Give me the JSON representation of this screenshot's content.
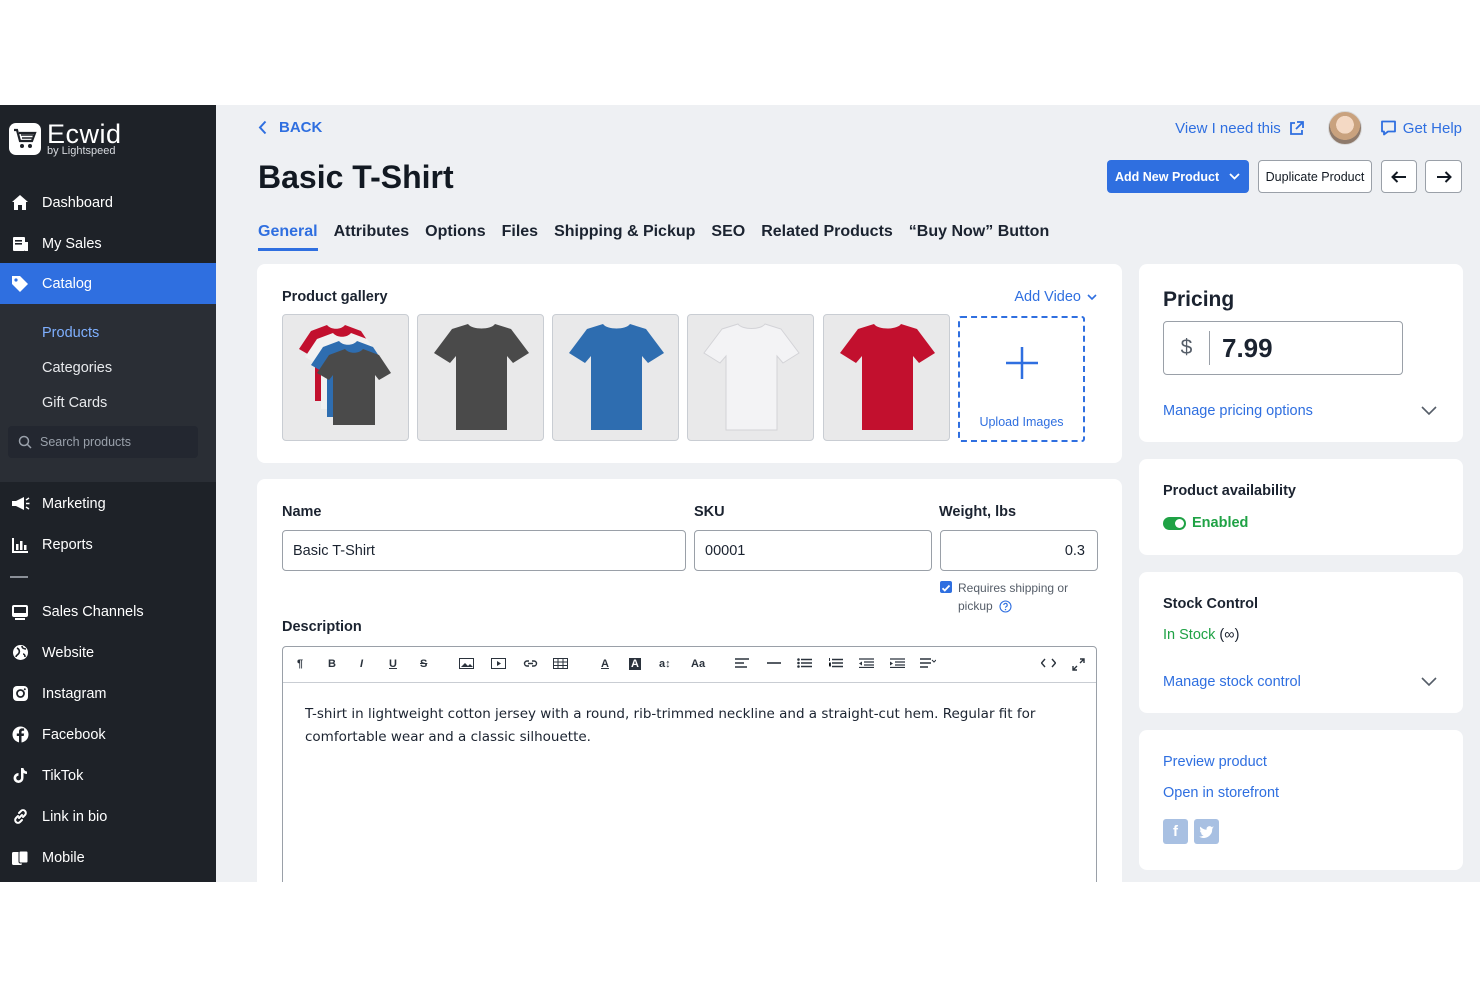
{
  "brand": {
    "name": "Ecwid",
    "sub": "by Lightspeed"
  },
  "sidebar": {
    "items": [
      {
        "label": "Dashboard",
        "icon": "home-icon"
      },
      {
        "label": "My Sales",
        "icon": "sales-icon"
      },
      {
        "label": "Catalog",
        "icon": "tag-icon",
        "active": true
      }
    ],
    "sub_items": [
      {
        "label": "Products",
        "active": true
      },
      {
        "label": "Categories"
      },
      {
        "label": "Gift Cards"
      }
    ],
    "search_placeholder": "Search products",
    "items2": [
      {
        "label": "Marketing",
        "icon": "megaphone-icon"
      },
      {
        "label": "Reports",
        "icon": "chart-icon"
      },
      {
        "label": "Sales Channels",
        "icon": "store-icon"
      },
      {
        "label": "Website",
        "icon": "globe-icon"
      },
      {
        "label": "Instagram",
        "icon": "instagram-icon"
      },
      {
        "label": "Facebook",
        "icon": "facebook-icon"
      },
      {
        "label": "TikTok",
        "icon": "tiktok-icon"
      },
      {
        "label": "Link in bio",
        "icon": "link-icon"
      },
      {
        "label": "Mobile",
        "icon": "mobile-icon"
      }
    ]
  },
  "header": {
    "back_label": "BACK",
    "title": "Basic T-Shirt",
    "view_link": "View I need this",
    "help_link": "Get Help",
    "add_new": "Add New Product",
    "duplicate": "Duplicate Product"
  },
  "tabs": [
    "General",
    "Attributes",
    "Options",
    "Files",
    "Shipping & Pickup",
    "SEO",
    "Related Products",
    "“Buy Now” Button"
  ],
  "gallery": {
    "title": "Product gallery",
    "add_video": "Add Video",
    "upload": "Upload Images",
    "thumbs": [
      {
        "kind": "stack"
      },
      {
        "kind": "single",
        "color": "#4a4a4a"
      },
      {
        "kind": "single",
        "color": "#2e6db0"
      },
      {
        "kind": "single",
        "color": "#e3e3e5"
      },
      {
        "kind": "single",
        "color": "#c2102e"
      }
    ]
  },
  "form": {
    "name_label": "Name",
    "name_value": "Basic T-Shirt",
    "sku_label": "SKU",
    "sku_value": "00001",
    "weight_label": "Weight, lbs",
    "weight_value": "0.3",
    "shipping_label_1": "Requires shipping or",
    "shipping_label_2": "pickup",
    "desc_label": "Description",
    "desc_text": "T-shirt in lightweight cotton jersey with a round, rib-trimmed neckline and a straight-cut hem. Regular fit for comfortable wear and a classic silhouette."
  },
  "pricing": {
    "title": "Pricing",
    "currency": "$",
    "price": "7.99",
    "manage": "Manage pricing options"
  },
  "availability": {
    "title": "Product availability",
    "status": "Enabled"
  },
  "stock": {
    "title": "Stock Control",
    "status": "In Stock",
    "qty": "(∞)",
    "manage": "Manage stock control"
  },
  "links": {
    "preview": "Preview product",
    "storefront": "Open in storefront"
  },
  "colors": {
    "accent": "#2f6fe0",
    "sidebar": "#1e2228",
    "success": "#1fa245"
  }
}
